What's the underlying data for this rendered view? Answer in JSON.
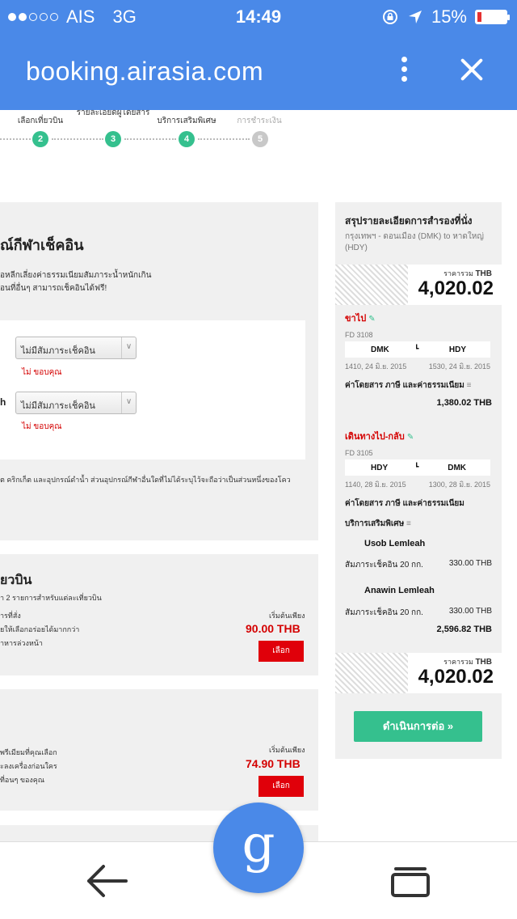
{
  "status": {
    "carrier": "AIS",
    "network": "3G",
    "time": "14:49",
    "battery": "15%",
    "battery_level": 0.15,
    "battery_color": "#e53030"
  },
  "browser": {
    "url": "booking.airasia.com",
    "menu_icon": "more-vert-icon",
    "close_icon": "close-icon"
  },
  "stepper": {
    "steps": [
      {
        "label": "เลือกเที่ยวบิน",
        "num": "2"
      },
      {
        "label": "รายละเอียดผู้โดยสาร",
        "num": "3"
      },
      {
        "label": "บริการเสริมพิเศษ",
        "num": "4"
      },
      {
        "label": "การชำระเงิน",
        "num": "5"
      }
    ]
  },
  "baggage": {
    "title": "ณ์กีฬาเช็คอิน",
    "desc1": "ื่อหลีกเลี่ยงค่าธรรมเนียมสัมภาระน้ำหนักเกิน",
    "desc2": "อนที่อื่นๆ สามารถเช็คอินได้ฟรี!",
    "rows": [
      {
        "name_tail": "",
        "select_value": "ไม่มีสัมภาระเช็คอิน",
        "note": "ไม่ ขอบคุณ"
      },
      {
        "name_tail": "h",
        "select_value": "ไม่มีสัมภาระเช็คอิน",
        "note": "ไม่ ขอบคุณ"
      }
    ],
    "footnote": "ต คริกเก็ต และอุปกรณ์ดำน้ำ ส่วนอุปกรณ์กีฬาอื่นใดที่ไม่ได้ระบุไว้จะถือว่าเป็นส่วนหนึ่งของโคว"
  },
  "meal": {
    "title": "ยวบิน",
    "desc": "า 2 รายการสำหรับแต่ละเที่ยวบิน",
    "lines": [
      "ารที่สั่ง",
      "ยให้เลือกอร่อยได้มากกว่า",
      "าหารล่วงหน้า"
    ],
    "price_label": "เริ่มต้นเพียง",
    "price": "90.00 THB",
    "button": "เลือก"
  },
  "seat": {
    "lines": [
      "พรีเมียมที่คุณเลือก",
      "ะลงเครื่องก่อนใคร",
      "ที่อนๆ ของคุณ"
    ],
    "price_label": "เริ่มต้นเพียง",
    "price": "74.90 THB",
    "button": "เลือก"
  },
  "summary": {
    "title": "สรุปรายละเอียดการสำรองที่นั่ง",
    "route": "กรุงเทพฯ - ดอนเมือง (DMK) to หาดใหญ่ (HDY)",
    "total_label": "ราคารวม",
    "currency": "THB",
    "total": "4,020.02",
    "outbound": {
      "title": "ขาไป",
      "flight": "FD 3108",
      "from": "DMK",
      "to": "HDY",
      "dep": "1410, 24 มิ.ย. 2015",
      "arr": "1530, 24 มิ.ย. 2015",
      "fee_label": "ค่าโดยสาร ภาษี และค่าธรรมเนียม",
      "fee": "1,380.02 THB"
    },
    "return": {
      "title": "เดินทางไป-กลับ",
      "flight": "FD 3105",
      "from": "HDY",
      "to": "DMK",
      "dep": "1140, 28 มิ.ย. 2015",
      "arr": "1300, 28 มิ.ย. 2015",
      "fee_label": "ค่าโดยสาร ภาษี และค่าธรรมเนียม",
      "extras_label": "บริการเสริมพิเศษ",
      "passengers": [
        {
          "name": "Usob Lemleah",
          "item": "สัมภาระเช็คอิน 20 กก.",
          "price": "330.00 THB"
        },
        {
          "name": "Anawin Lemleah",
          "item": "สัมภาระเช็คอิน 20 กก.",
          "price": "330.00 THB"
        }
      ],
      "subtotal": "2,596.82 THB"
    },
    "continue": "ดำเนินการต่อ »"
  },
  "nav": {
    "back_icon": "back-arrow-icon",
    "google_label": "g",
    "tabs_icon": "tabs-icon"
  }
}
